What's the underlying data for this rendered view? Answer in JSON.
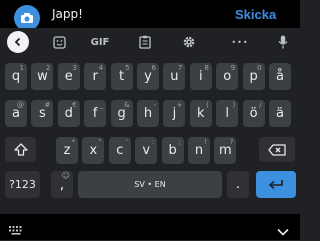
{
  "compose": {
    "message_text": "Japp!",
    "send_label": "Skicka",
    "camera_icon": "camera-icon"
  },
  "keyboard": {
    "toolbar": {
      "back_icon": "chevron-left-icon",
      "gif_label": "GIF",
      "more_label": "•••"
    },
    "rows": [
      [
        {
          "label": "q",
          "hint": "1"
        },
        {
          "label": "w",
          "hint": "2"
        },
        {
          "label": "e",
          "hint": "3"
        },
        {
          "label": "r",
          "hint": "4"
        },
        {
          "label": "t",
          "hint": "5"
        },
        {
          "label": "y",
          "hint": "6"
        },
        {
          "label": "u",
          "hint": "7"
        },
        {
          "label": "i",
          "hint": "8"
        },
        {
          "label": "o",
          "hint": "9"
        },
        {
          "label": "p",
          "hint": "0"
        },
        {
          "label": "å",
          "hint": ""
        }
      ],
      [
        {
          "label": "a",
          "hint": "@"
        },
        {
          "label": "s",
          "hint": "#"
        },
        {
          "label": "d",
          "hint": "€"
        },
        {
          "label": "f",
          "hint": "_"
        },
        {
          "label": "g",
          "hint": "&"
        },
        {
          "label": "h",
          "hint": "-"
        },
        {
          "label": "j",
          "hint": "+"
        },
        {
          "label": "k",
          "hint": "("
        },
        {
          "label": "l",
          "hint": ")"
        },
        {
          "label": "ö",
          "hint": "/"
        },
        {
          "label": "ä",
          "hint": ""
        }
      ],
      [
        {
          "label": "z",
          "hint": "*"
        },
        {
          "label": "x",
          "hint": "\""
        },
        {
          "label": "c",
          "hint": "'"
        },
        {
          "label": "v",
          "hint": ":"
        },
        {
          "label": "b",
          "hint": ";"
        },
        {
          "label": "n",
          "hint": "!"
        },
        {
          "label": "m",
          "hint": "?"
        }
      ]
    ],
    "symbols_label": "?123",
    "emoji_comma_label": ",",
    "emoji_hint": "☺",
    "space_label": "SV • EN",
    "period_label": ".",
    "enter_icon": "enter-arrow-icon",
    "shift_icon": "shift-icon",
    "backspace_icon": "backspace-icon"
  },
  "nav": {
    "keyboard_switch_icon": "keyboard-icon",
    "hide_keyboard_icon": "chevron-down-icon"
  },
  "colors": {
    "accent": "#3d8fe0",
    "key": "#3c4043",
    "function_key": "#303134",
    "keyboard_bg": "#202124"
  }
}
